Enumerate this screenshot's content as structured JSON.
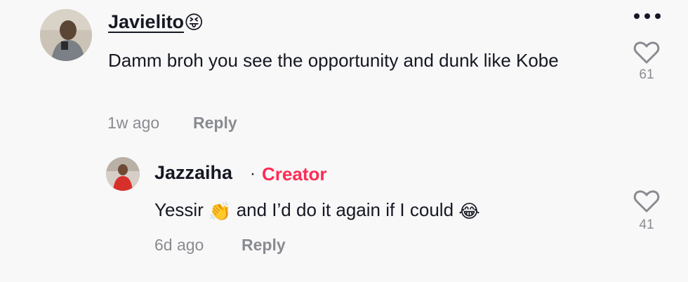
{
  "comments": [
    {
      "username": "Javielito",
      "username_emoji": "😝",
      "text": "Damm broh you see the opportunity and dunk like Kobe",
      "time": "1w ago",
      "reply_label": "Reply",
      "like_count": "61"
    },
    {
      "username": "Jazzaiha",
      "separator": "·",
      "badge": "Creator",
      "text_part1": "Yessir",
      "text_emoji1": "👏",
      "text_part2": "and I’d do it again if I could",
      "text_emoji2": "😂",
      "time": "6d ago",
      "reply_label": "Reply",
      "like_count": "41"
    }
  ],
  "icons": {
    "more": "more-horizontal-icon",
    "like": "heart-outline-icon"
  },
  "colors": {
    "creator_badge": "#fe2c55",
    "secondary_text": "#8a8b91",
    "primary_text": "#161823",
    "background": "#f8f8f8"
  }
}
